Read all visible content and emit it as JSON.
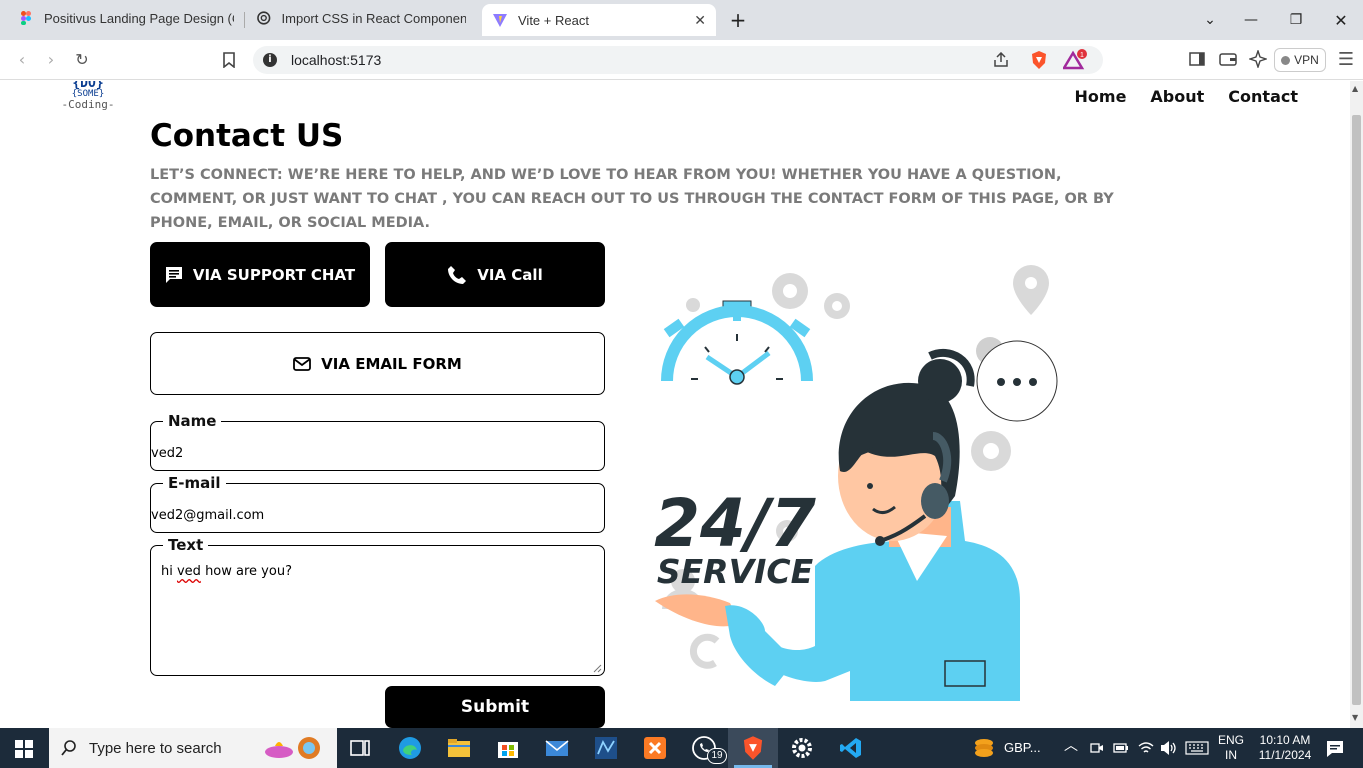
{
  "browser": {
    "tabs": [
      {
        "title": "Positivus Landing Page Design (Com",
        "icon": "figma-icon"
      },
      {
        "title": "Import CSS in React Component",
        "icon": "openai-icon"
      },
      {
        "title": "Vite + React",
        "icon": "vite-icon",
        "active": true
      }
    ],
    "new_tab": "+",
    "url": "localhost:5173",
    "vpn_label": "VPN",
    "badge_count": "1"
  },
  "page": {
    "logo": {
      "line1": "{DO}",
      "line2": "{SOME}",
      "line3": "-Coding-"
    },
    "nav": [
      "Home",
      "About",
      "Contact"
    ],
    "title": "Contact US",
    "lead": "LET’S CONNECT: WE’RE HERE TO HELP, AND WE’D LOVE TO HEAR FROM YOU! WHETHER YOU HAVE A QUESTION, COMMENT, OR JUST WANT TO CHAT , YOU CAN REACH OUT TO US THROUGH THE CONTACT FORM OF THIS PAGE, OR BY PHONE, EMAIL, OR SOCIAL MEDIA.",
    "buttons": {
      "support_chat": "VIA SUPPORT CHAT",
      "call": "VIA Call",
      "email_form": "VIA EMAIL FORM",
      "submit": "Submit"
    },
    "form": {
      "name_label": "Name",
      "name_value": "ved2",
      "email_label": "E-mail",
      "email_value": "ved2@gmail.com",
      "text_label": "Text",
      "text_value_pre": "hi ",
      "text_value_misspelled": "ved",
      "text_value_post": " how are you?"
    },
    "illustration": {
      "big_text": "24/7",
      "sub_text": "SERVICE"
    }
  },
  "taskbar": {
    "search_placeholder": "Type here to search",
    "whatsapp_badge": "19",
    "weather": "GBP...",
    "lang_line1": "ENG",
    "lang_line2": "IN",
    "time": "10:10 AM",
    "date": "11/1/2024"
  },
  "colors": {
    "accent_blue": "#5dd0f2",
    "dark": "#263238",
    "chrome": "#dee1e6",
    "taskbar": "#1c2b3a"
  }
}
